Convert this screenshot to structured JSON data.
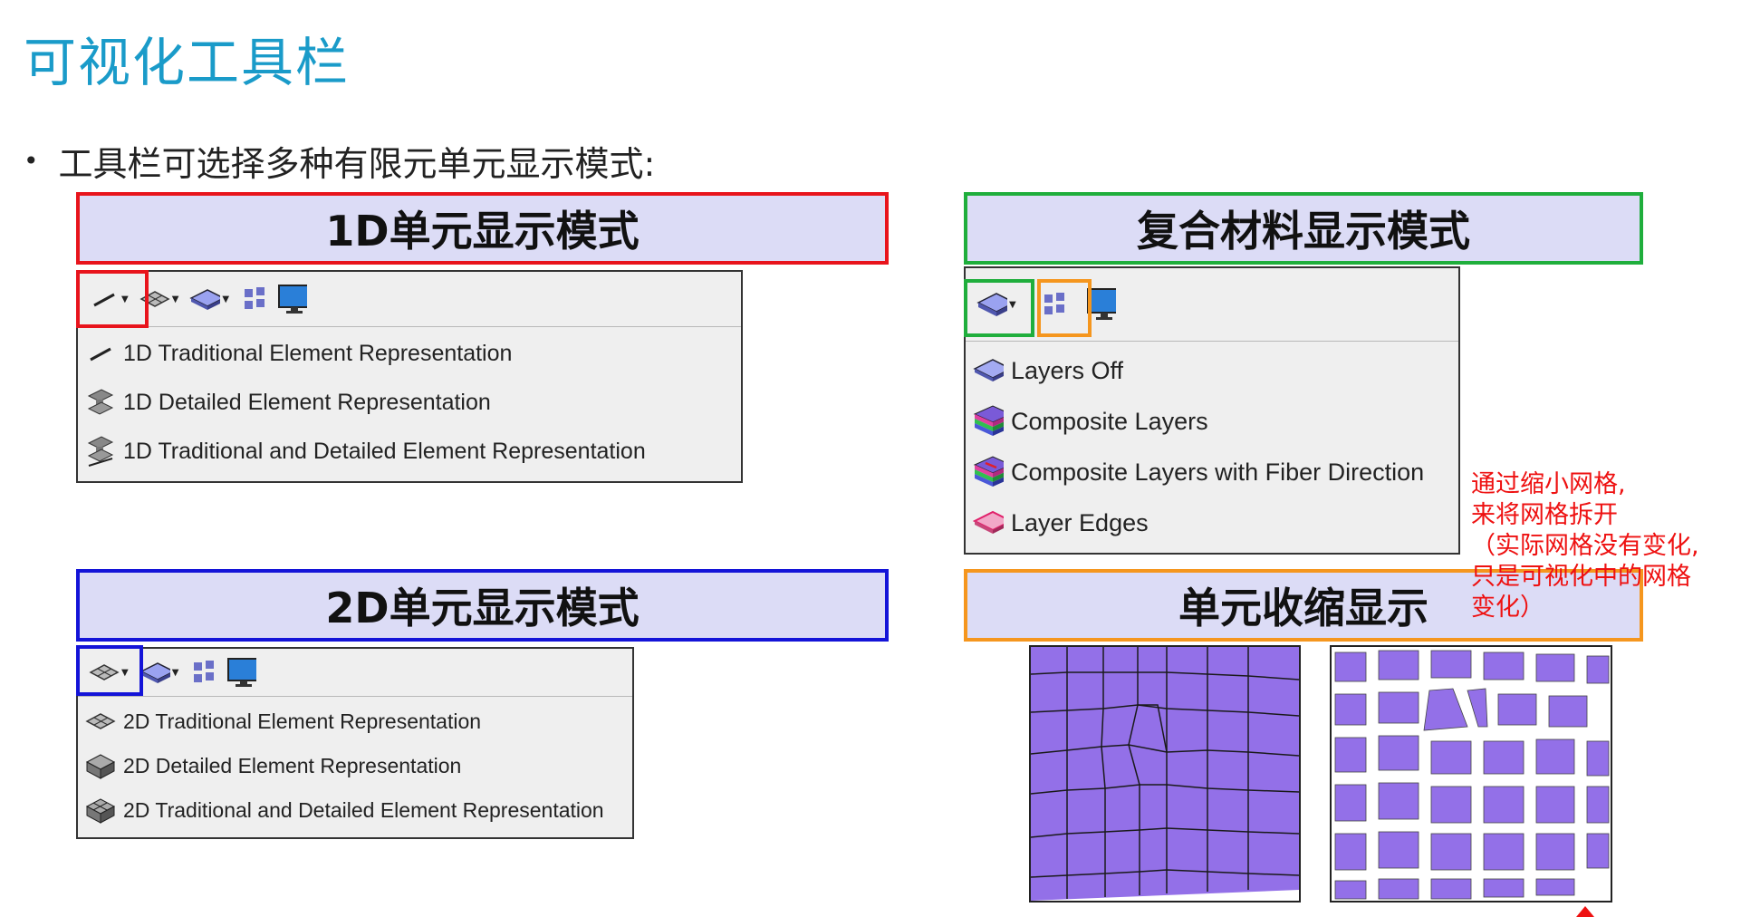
{
  "page": {
    "title": "可视化工具栏",
    "bullet": "工具栏可选择多种有限元单元显示模式:"
  },
  "sections": {
    "d1": {
      "header": "1D单元显示模式",
      "items": [
        "1D Traditional Element Representation",
        "1D Detailed Element Representation",
        "1D Traditional and Detailed Element Representation"
      ]
    },
    "composite": {
      "header": "复合材料显示模式",
      "items": [
        "Layers Off",
        "Composite Layers",
        "Composite Layers with Fiber Direction",
        "Layer Edges"
      ]
    },
    "d2": {
      "header": "2D单元显示模式",
      "items": [
        "2D Traditional Element Representation",
        "2D Detailed Element Representation",
        "2D Traditional and Detailed Element Representation"
      ]
    },
    "shrink": {
      "header": "单元收缩显示"
    }
  },
  "note": "通过缩小网格,\n来将网格拆开\n（实际网格没有变化,\n只是可视化中的网格\n变化）",
  "colors": {
    "title": "#1a9bc9",
    "header_bg": "#dcdcf6",
    "d1_border": "#e8141c",
    "composite_border": "#1fae3c",
    "d2_border": "#1414d8",
    "shrink_border": "#f5961e",
    "mesh_fill": "#9370e8",
    "note_text": "#e11111"
  }
}
